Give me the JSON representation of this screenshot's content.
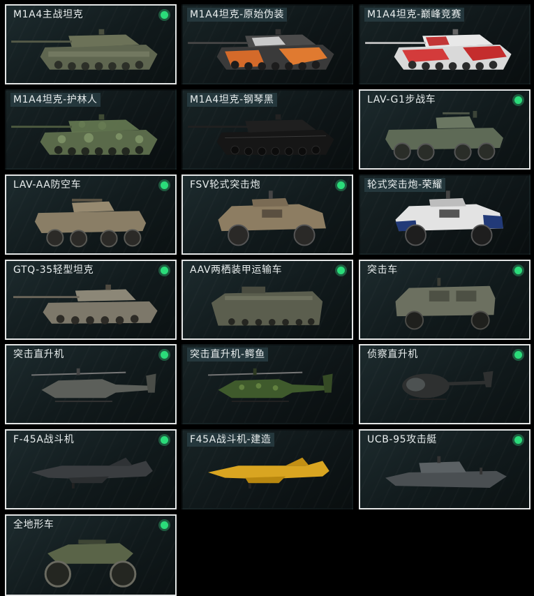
{
  "vehicles": [
    {
      "name": "M1A4主战坦克",
      "owned": true,
      "icon": "tank-icon"
    },
    {
      "name": "M1A4坦克-原始伪装",
      "owned": false,
      "icon": "tank-icon"
    },
    {
      "name": "M1A4坦克-巅峰竞赛",
      "owned": false,
      "icon": "tank-icon"
    },
    {
      "name": "M1A4坦克-护林人",
      "owned": false,
      "icon": "tank-icon"
    },
    {
      "name": "M1A4坦克-钢琴黑",
      "owned": false,
      "icon": "tank-icon"
    },
    {
      "name": "LAV-G1步战车",
      "owned": true,
      "icon": "ifv-icon"
    },
    {
      "name": "LAV-AA防空车",
      "owned": true,
      "icon": "aa-vehicle-icon"
    },
    {
      "name": "FSV轮式突击炮",
      "owned": true,
      "icon": "armored-car-icon"
    },
    {
      "name": "轮式突击炮-荣耀",
      "owned": false,
      "icon": "armored-car-icon"
    },
    {
      "name": "GTQ-35轻型坦克",
      "owned": true,
      "icon": "light-tank-icon"
    },
    {
      "name": "AAV两栖装甲运输车",
      "owned": true,
      "icon": "amphibious-apc-icon"
    },
    {
      "name": "突击车",
      "owned": true,
      "icon": "assault-vehicle-icon"
    },
    {
      "name": "突击直升机",
      "owned": true,
      "icon": "attack-helicopter-icon"
    },
    {
      "name": "突击直升机-鳄鱼",
      "owned": false,
      "icon": "attack-helicopter-icon"
    },
    {
      "name": "侦察直升机",
      "owned": true,
      "icon": "scout-helicopter-icon"
    },
    {
      "name": "F-45A战斗机",
      "owned": true,
      "icon": "fighter-jet-icon"
    },
    {
      "name": "F45A战斗机-建造",
      "owned": false,
      "icon": "fighter-jet-icon"
    },
    {
      "name": "UCB-95攻击艇",
      "owned": true,
      "icon": "attack-boat-icon"
    },
    {
      "name": "全地形车",
      "owned": true,
      "icon": "atv-icon"
    }
  ],
  "colors": {
    "owned_border": "#e4e6e6",
    "owned_badge": "#2bdc7a",
    "card_bg": "#15201f",
    "text": "#e9eeee"
  }
}
